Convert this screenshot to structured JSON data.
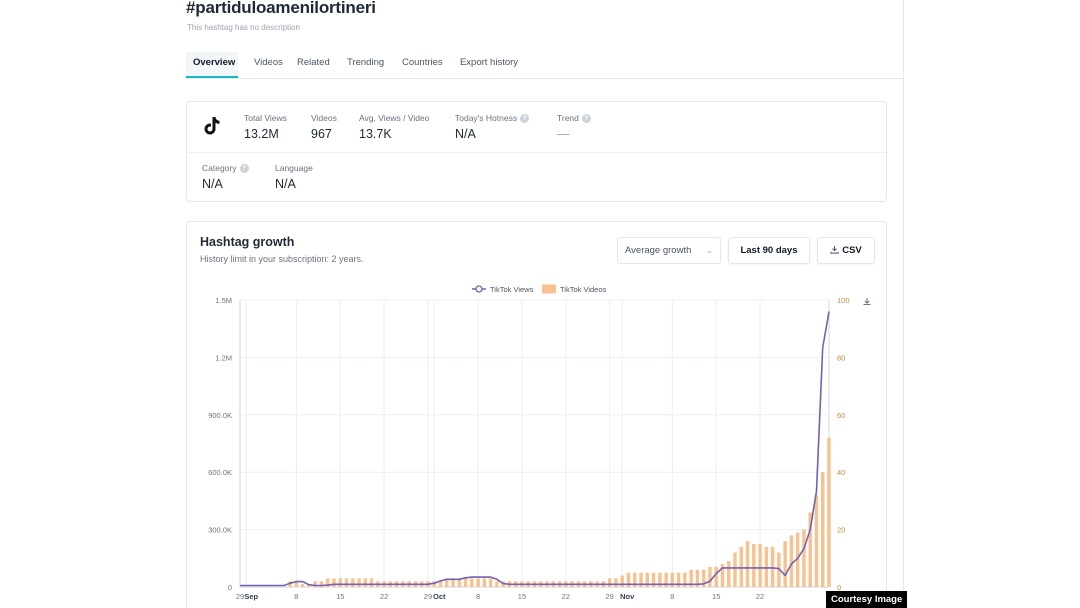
{
  "header": {
    "title": "#partiduloamenilortineri",
    "description": "This hashtag has no description"
  },
  "tabs": [
    {
      "label": "Overview",
      "active": true
    },
    {
      "label": "Videos",
      "active": false
    },
    {
      "label": "Related",
      "active": false
    },
    {
      "label": "Trending",
      "active": false
    },
    {
      "label": "Countries",
      "active": false
    },
    {
      "label": "Export history",
      "active": false
    }
  ],
  "stats": {
    "total_views": {
      "label": "Total Views",
      "value": "13.2M"
    },
    "videos": {
      "label": "Videos",
      "value": "967"
    },
    "avg_views": {
      "label": "Avg. Views / Video",
      "value": "13.7K"
    },
    "hotness": {
      "label": "Today's Hotness",
      "value": "N/A"
    },
    "trend": {
      "label": "Trend",
      "value": "—"
    },
    "category": {
      "label": "Category",
      "value": "N/A"
    },
    "language": {
      "label": "Language",
      "value": "N/A"
    }
  },
  "growth": {
    "title": "Hashtag growth",
    "subtitle": "History limit in your subscription: 2 years.",
    "dropdown_value": "Average growth",
    "range_button": "Last 90 days",
    "csv_button": "CSV"
  },
  "courtesy": "Courtesy Image",
  "colors": {
    "accent": "#1ab7c4",
    "views_line": "#7461b0",
    "videos_bar": "#f7c290"
  },
  "chart_data": {
    "type": "bar",
    "legend": [
      "TikTok Views",
      "TikTok Videos"
    ],
    "legend_position": "top",
    "grid": true,
    "y_left_ticks": [
      "0",
      "300.0K",
      "600.0K",
      "900.0K",
      "1.2M",
      "1.5M"
    ],
    "y_left_range": [
      0,
      1500000
    ],
    "y_right_ticks": [
      "0",
      "20",
      "40",
      "60",
      "80",
      "100"
    ],
    "y_right_range": [
      0,
      100
    ],
    "x_tick_labels": [
      {
        "label": "29",
        "day": 0
      },
      {
        "label": "Sep",
        "day": 1,
        "bold": true
      },
      {
        "label": "8",
        "day": 9
      },
      {
        "label": "15",
        "day": 16
      },
      {
        "label": "22",
        "day": 23
      },
      {
        "label": "29",
        "day": 30
      },
      {
        "label": "Oct",
        "day": 31,
        "bold": true
      },
      {
        "label": "8",
        "day": 38
      },
      {
        "label": "15",
        "day": 45
      },
      {
        "label": "22",
        "day": 52
      },
      {
        "label": "29",
        "day": 59
      },
      {
        "label": "Nov",
        "day": 61,
        "bold": true
      },
      {
        "label": "8",
        "day": 69
      },
      {
        "label": "15",
        "day": 76
      },
      {
        "label": "22",
        "day": 83
      }
    ],
    "series": [
      {
        "name": "TikTok Videos",
        "type": "bar",
        "axis": "right",
        "values": [
          0,
          0,
          0,
          0,
          0,
          0,
          0,
          0,
          2,
          2,
          1,
          1,
          2,
          2,
          3,
          3,
          3,
          3,
          3,
          3,
          3,
          3,
          2,
          2,
          2,
          2,
          2,
          2,
          2,
          2,
          2,
          2,
          2,
          3,
          3,
          3,
          3,
          3,
          3,
          3,
          3,
          2,
          2,
          2,
          2,
          2,
          2,
          2,
          2,
          2,
          2,
          2,
          2,
          2,
          2,
          2,
          2,
          2,
          2,
          3,
          3,
          4,
          5,
          5,
          5,
          5,
          5,
          5,
          5,
          5,
          5,
          5,
          6,
          6,
          6,
          7,
          7,
          8,
          9,
          12,
          14,
          16,
          15,
          15,
          14,
          14,
          12,
          16,
          18,
          19,
          20,
          26,
          32,
          40,
          52
        ]
      },
      {
        "name": "TikTok Views",
        "type": "line",
        "axis": "left",
        "values": [
          8000,
          8000,
          8000,
          8000,
          8000,
          8000,
          8000,
          8000,
          20000,
          28000,
          28000,
          12000,
          8000,
          8000,
          10000,
          14000,
          14000,
          14000,
          14000,
          14000,
          14000,
          14000,
          14000,
          14000,
          14000,
          14000,
          14000,
          14000,
          14000,
          14000,
          14000,
          20000,
          32000,
          40000,
          40000,
          40000,
          48000,
          52000,
          52000,
          52000,
          52000,
          40000,
          18000,
          14000,
          14000,
          14000,
          14000,
          14000,
          14000,
          14000,
          14000,
          14000,
          14000,
          14000,
          14000,
          14000,
          14000,
          14000,
          14000,
          14000,
          14000,
          14000,
          14000,
          14000,
          14000,
          14000,
          14000,
          14000,
          14000,
          14000,
          14000,
          14000,
          14000,
          14000,
          16000,
          30000,
          70000,
          100000,
          100000,
          100000,
          100000,
          100000,
          100000,
          100000,
          100000,
          100000,
          96000,
          60000,
          120000,
          150000,
          200000,
          300000,
          500000,
          1250000,
          1440000
        ]
      }
    ]
  }
}
